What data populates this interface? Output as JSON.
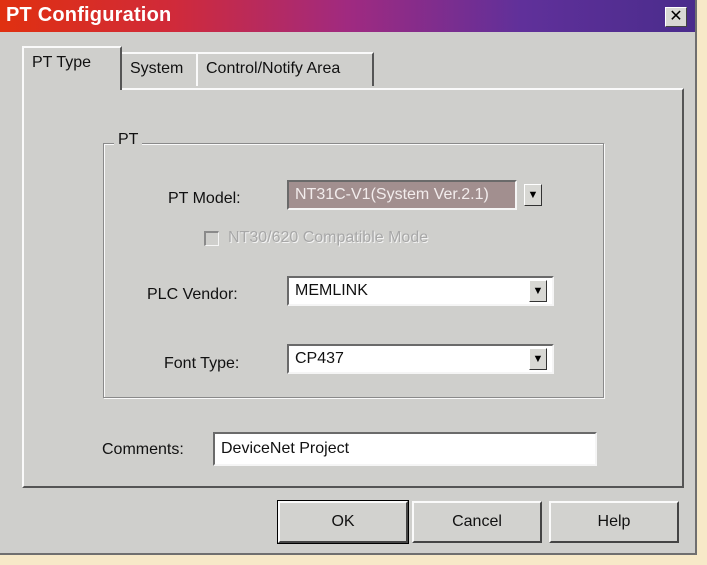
{
  "window": {
    "title": "PT Configuration",
    "close_glyph": "✕"
  },
  "tabs": [
    {
      "label": "PT Type",
      "active": true
    },
    {
      "label": "System",
      "active": false
    },
    {
      "label": "Control/Notify Area",
      "active": false
    }
  ],
  "group": {
    "title": "PT"
  },
  "fields": {
    "pt_model": {
      "label": "PT Model:",
      "value": "NT31C-V1(System Ver.2.1)"
    },
    "compatible_mode": {
      "label": "NT30/620 Compatible Mode",
      "checked": false,
      "enabled": false
    },
    "plc_vendor": {
      "label": "PLC Vendor:",
      "value": "MEMLINK"
    },
    "font_type": {
      "label": "Font Type:",
      "value": "CP437"
    },
    "comments": {
      "label": "Comments:",
      "value": "DeviceNet Project"
    }
  },
  "buttons": {
    "ok": "OK",
    "cancel": "Cancel",
    "help": "Help"
  },
  "icons": {
    "dropdown": "chevron-down-icon",
    "close": "close-icon"
  },
  "colors": {
    "title_gradient_start": "#e03010",
    "title_gradient_end": "#4a2c8c",
    "dialog_bg": "#cfcfcc",
    "disabled_field_bg": "#a28f8f"
  }
}
